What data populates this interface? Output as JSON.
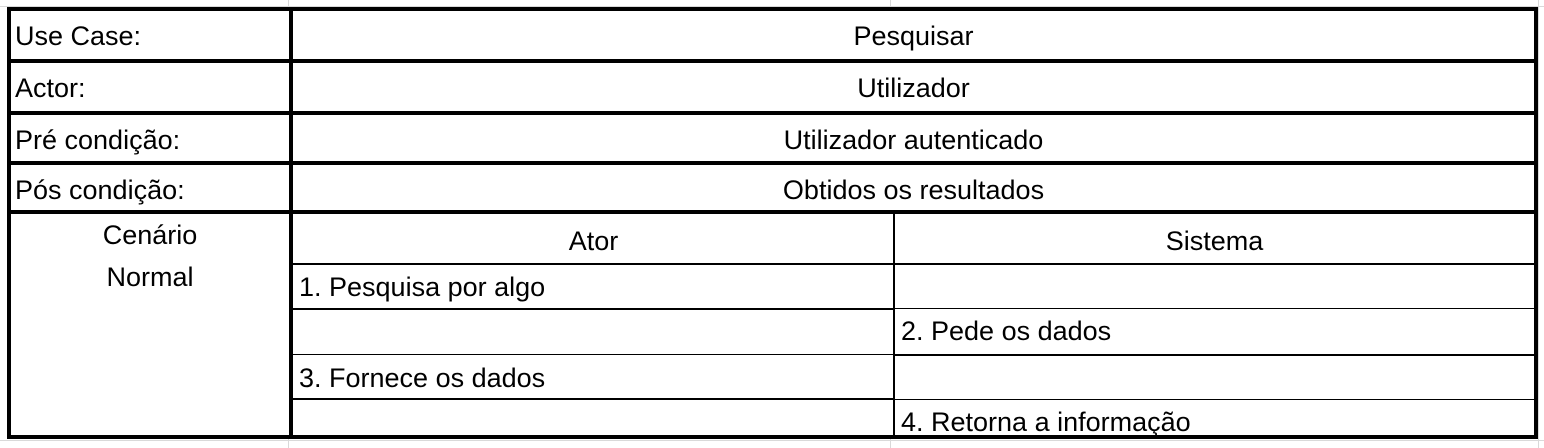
{
  "use_case": {
    "rows": [
      {
        "label": "Use Case:",
        "value": "Pesquisar"
      },
      {
        "label": "Actor:",
        "value": "Utilizador"
      },
      {
        "label": "Pré condição:",
        "value": "Utilizador autenticado"
      },
      {
        "label": "Pós condição:",
        "value": "Obtidos os resultados"
      }
    ],
    "scenario": {
      "label_line1": "Cenário",
      "label_line2": "Normal",
      "col_ator": "Ator",
      "col_sistema": "Sistema",
      "steps": [
        {
          "ator": "1. Pesquisa por algo",
          "sistema": ""
        },
        {
          "ator": "",
          "sistema": "2. Pede os dados"
        },
        {
          "ator": "3. Fornece os dados",
          "sistema": ""
        },
        {
          "ator": "",
          "sistema": "4. Retorna a informação"
        }
      ]
    }
  }
}
